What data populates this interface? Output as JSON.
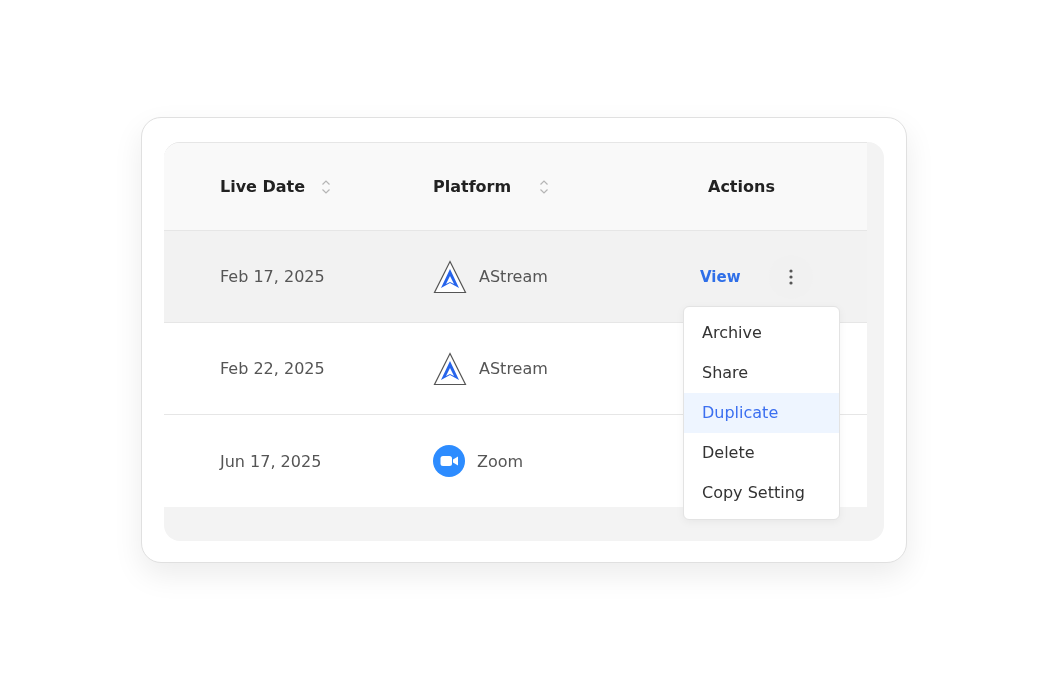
{
  "table": {
    "columns": [
      {
        "label": "Live Date",
        "sortable": true
      },
      {
        "label": "Platform",
        "sortable": true
      },
      {
        "label": "Actions",
        "sortable": false
      }
    ],
    "rows": [
      {
        "live_date": "Feb 17, 2025",
        "platform": {
          "kind": "astream",
          "name": "AStream"
        },
        "highlighted": true,
        "view_link": "View"
      },
      {
        "live_date": "Feb 22, 2025",
        "platform": {
          "kind": "astream",
          "name": "AStream"
        },
        "highlighted": false
      },
      {
        "live_date": "Jun 17, 2025",
        "platform": {
          "kind": "zoom",
          "name": "Zoom"
        },
        "highlighted": false
      }
    ]
  },
  "menu": {
    "items": [
      {
        "label": "Archive",
        "selected": false
      },
      {
        "label": "Share",
        "selected": false
      },
      {
        "label": "Duplicate",
        "selected": true
      },
      {
        "label": "Delete",
        "selected": false
      },
      {
        "label": "Copy Setting",
        "selected": false
      }
    ]
  }
}
